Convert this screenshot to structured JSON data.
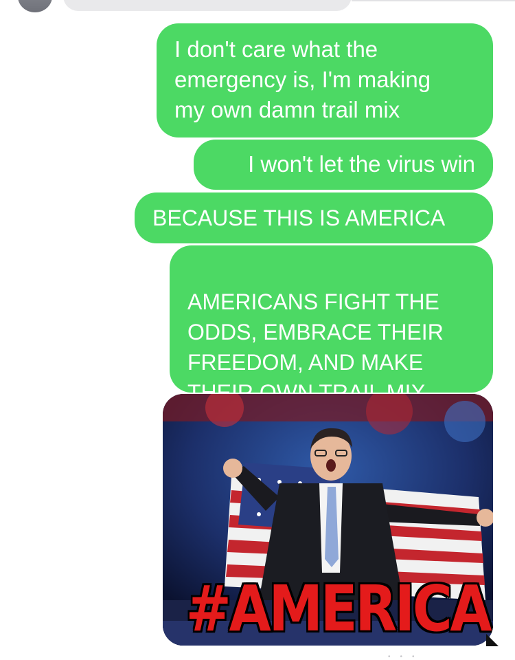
{
  "messages": [
    {
      "sender": "me",
      "text": "I don't care what the\nemergency is, I'm making\nmy own damn trail mix"
    },
    {
      "sender": "me",
      "text": "I won't let the virus win"
    },
    {
      "sender": "me",
      "text": "BECAUSE THIS IS AMERICA"
    },
    {
      "sender": "me",
      "text": "AMERICANS FIGHT THE\nODDS, EMBRACE THEIR\nFREEDOM, AND MAKE\nTHEIR OWN TRAIL MIX"
    }
  ],
  "gif": {
    "caption": "#AMERICA",
    "depicts": "man in suit holding american flag"
  },
  "colors": {
    "sent_bubble": "#4cd964",
    "received_bubble": "#e9e9eb",
    "caption_red": "#e41b1b"
  }
}
